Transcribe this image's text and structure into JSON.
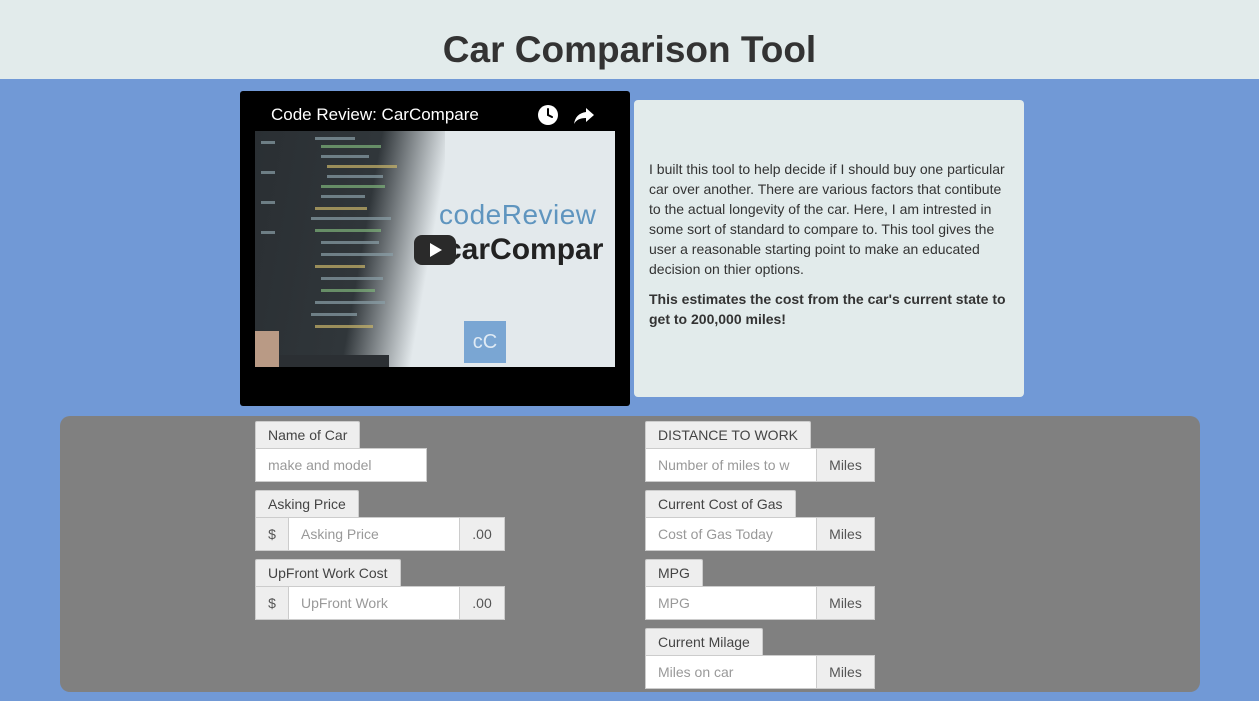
{
  "header": {
    "title": "Car Comparison Tool"
  },
  "video": {
    "title": "Code Review: CarCompare",
    "thumb_brand_line1": "codeReview",
    "thumb_brand_line2": "carCompar",
    "thumb_logo": "cC"
  },
  "description": {
    "paragraph": "I built this tool to help decide if I should buy one particular car over another. There are various factors that contibute to the actual longevity of the car. Here, I am intrested in some sort of standard to compare to. This tool gives the user a reasonable starting point to make an educated decision on thier options.",
    "emphasis": "This estimates the cost from the car's current state to get to 200,000 miles!"
  },
  "form": {
    "name_of_car": {
      "label": "Name of Car",
      "placeholder": "make and model"
    },
    "asking_price": {
      "label": "Asking Price",
      "prefix": "$",
      "placeholder": "Asking Price",
      "suffix": ".00"
    },
    "upfront_work": {
      "label": "UpFront Work Cost",
      "prefix": "$",
      "placeholder": "UpFront Work",
      "suffix": ".00"
    },
    "distance": {
      "label": "DISTANCE TO WORK",
      "placeholder": "Number of miles to w",
      "suffix": "Miles"
    },
    "gas_cost": {
      "label": "Current Cost of Gas",
      "placeholder": "Cost of Gas Today",
      "suffix": "Miles"
    },
    "mpg": {
      "label": "MPG",
      "placeholder": "MPG",
      "suffix": "Miles"
    },
    "milage": {
      "label": "Current Milage",
      "placeholder": "Miles on car",
      "suffix": "Miles"
    }
  },
  "colors": {
    "page_background": "#7199d6",
    "header_background": "#e2ebeb",
    "form_panel": "#808080"
  }
}
